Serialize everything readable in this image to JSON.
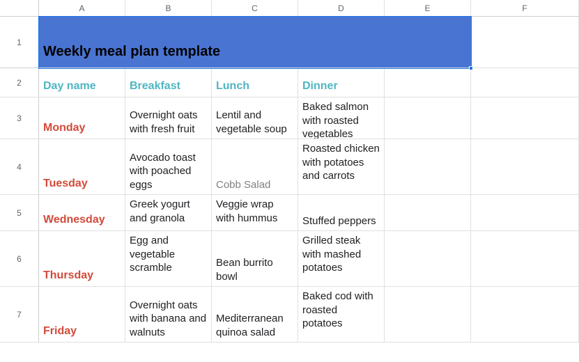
{
  "columns": [
    "A",
    "B",
    "C",
    "D",
    "E",
    "F"
  ],
  "rowLabels": [
    "1",
    "2",
    "3",
    "4",
    "5",
    "6",
    "7"
  ],
  "title": "Weekly meal plan template",
  "headers": {
    "day": "Day name",
    "breakfast": "Breakfast",
    "lunch": "Lunch",
    "dinner": "Dinner"
  },
  "rows": [
    {
      "day": "Monday",
      "breakfast": "Overnight oats with fresh fruit",
      "lunch": "Lentil and vegetable soup",
      "dinner": "Baked salmon with roasted vegetables"
    },
    {
      "day": "Tuesday",
      "breakfast": "Avocado toast with poached eggs",
      "lunch": "Cobb Salad",
      "dinner": "Roasted chicken with potatoes and carrots"
    },
    {
      "day": "Wednesday",
      "breakfast": "Greek yogurt and granola",
      "lunch": "Veggie wrap with hummus",
      "dinner": "Stuffed peppers"
    },
    {
      "day": "Thursday",
      "breakfast": "Egg and vegetable scramble",
      "lunch": "Bean burrito bowl",
      "dinner": "Grilled steak with mashed potatoes"
    },
    {
      "day": "Friday",
      "breakfast": "Overnight oats with banana and walnuts",
      "lunch": "Mediterranean quinoa salad",
      "dinner": "Baked cod with roasted potatoes"
    }
  ],
  "colors": {
    "titleBg": "#4a74d2",
    "headerText": "#4fb6c2",
    "dayText": "#d24a3a",
    "selection": "#1a73e8"
  }
}
